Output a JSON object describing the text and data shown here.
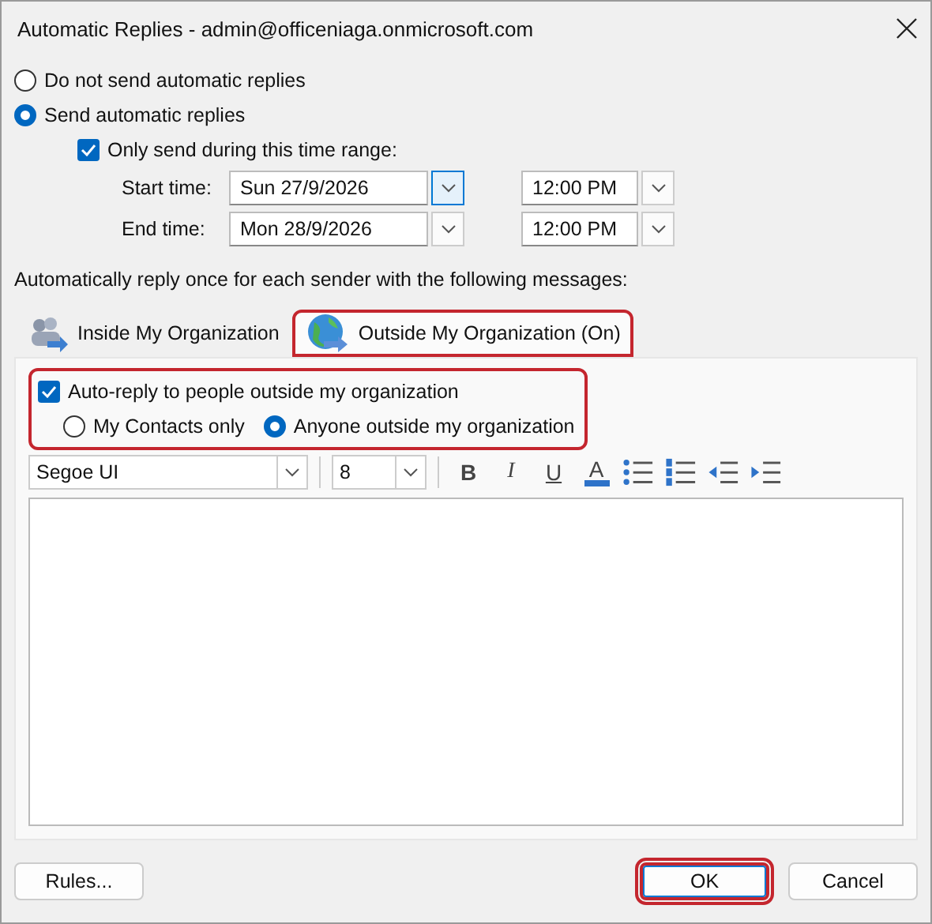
{
  "window": {
    "title": "Automatic Replies - admin@officeniaga.onmicrosoft.com"
  },
  "mode_options": [
    {
      "label": "Do not send automatic replies",
      "selected": false
    },
    {
      "label": "Send automatic replies",
      "selected": true
    }
  ],
  "time_range": {
    "label": "Only send during this time range:",
    "checked": true
  },
  "times": [
    {
      "label": "Start time:",
      "date": "Sun 27/9/2026",
      "time": "12:00 PM",
      "focused": true
    },
    {
      "label": "End time:",
      "date": "Mon 28/9/2026",
      "time": "12:00 PM",
      "focused": false
    }
  ],
  "instructions": "Automatically reply once for each sender with the following messages:",
  "tabs": [
    {
      "label": "Inside My Organization",
      "selected": false,
      "highlighted": false,
      "kind": "people"
    },
    {
      "label": "Outside My Organization (On)",
      "selected": true,
      "highlighted": true,
      "kind": "globe"
    }
  ],
  "auto_reply": {
    "label": "Auto-reply to people outside my organization",
    "checked": true,
    "highlighted": true
  },
  "audience": [
    {
      "label": "My Contacts only",
      "selected": false
    },
    {
      "label": "Anyone outside my organization",
      "selected": true
    }
  ],
  "toolbar": {
    "font": "Segoe UI",
    "size": "8",
    "buttons": [
      {
        "kind": "bold",
        "label": "B"
      },
      {
        "kind": "italic",
        "label": "I"
      },
      {
        "kind": "underline",
        "label": "U"
      },
      {
        "kind": "font_color",
        "label": "A"
      },
      {
        "kind": "bullets"
      },
      {
        "kind": "numbering"
      },
      {
        "kind": "outdent"
      },
      {
        "kind": "indent"
      }
    ]
  },
  "buttons": [
    {
      "label": "Rules...",
      "highlighted": false
    },
    {
      "label": "OK",
      "highlighted": true
    },
    {
      "label": "Cancel",
      "highlighted": false
    }
  ]
}
